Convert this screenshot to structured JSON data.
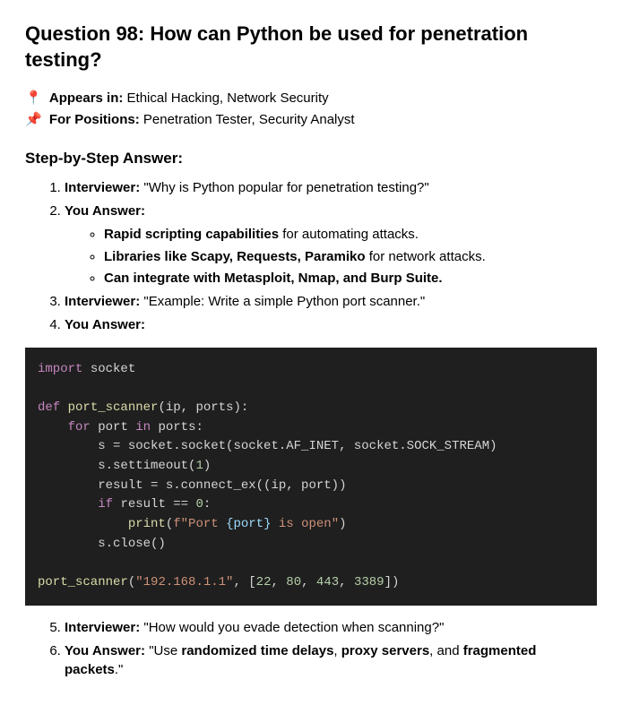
{
  "title": "Question 98: How can Python be used for penetration testing?",
  "meta": {
    "appears": {
      "emoji": "📍",
      "label": "Appears in:",
      "value": "Ethical Hacking, Network Security"
    },
    "positions": {
      "emoji": "📌",
      "label": "For Positions:",
      "value": "Penetration Tester, Security Analyst"
    }
  },
  "answer_heading": "Step-by-Step Answer:",
  "steps": {
    "s1": {
      "role": "Interviewer:",
      "text": "\"Why is Python popular for penetration testing?\""
    },
    "s2": {
      "role": "You Answer:"
    },
    "s2_bullets": {
      "b1": {
        "bold": "Rapid scripting capabilities",
        "rest": " for automating attacks."
      },
      "b2": {
        "bold": "Libraries like Scapy, Requests, Paramiko",
        "rest": " for network attacks."
      },
      "b3": {
        "bold": "Can integrate with Metasploit, Nmap, and Burp Suite."
      }
    },
    "s3": {
      "role": "Interviewer:",
      "text": "\"Example: Write a simple Python port scanner.\""
    },
    "s4": {
      "role": "You Answer:"
    },
    "s5": {
      "role": "Interviewer:",
      "text": "\"How would you evade detection when scanning?\""
    },
    "s6": {
      "role": "You Answer:",
      "pre": "\"Use ",
      "b1": "randomized time delays",
      "sep1": ", ",
      "b2": "proxy servers",
      "sep2": ", and ",
      "b3": "fragmented packets",
      "post": ".\""
    }
  },
  "code": {
    "l1_kw": "import",
    "l1_mod": "socket",
    "l2_kw": "def",
    "l2_fn": "port_scanner",
    "l2_args": "(ip, ports):",
    "l3_kw1": "for",
    "l3_id": "port",
    "l3_kw2": "in",
    "l3_rest": "ports:",
    "l4": "s = socket.socket(socket.AF_INET, socket.SOCK_STREAM)",
    "l5": "s.settimeout(",
    "l5_num": "1",
    "l5_end": ")",
    "l6": "result = s.connect_ex((ip, port))",
    "l7_kw": "if",
    "l7_rest": "result == ",
    "l7_num": "0",
    "l7_end": ":",
    "l8_fn": "print",
    "l8_par": "(",
    "l8_pre": "f\"Port ",
    "l8_br1": "{port}",
    "l8_post": " is open\"",
    "l8_end": ")",
    "l9": "s.close()",
    "l10_fn": "port_scanner",
    "l10_open": "(",
    "l10_str": "\"192.168.1.1\"",
    "l10_sep": ", [",
    "l10_n1": "22",
    "l10_c": ", ",
    "l10_n2": "80",
    "l10_n3": "443",
    "l10_n4": "3389",
    "l10_close": "])"
  }
}
